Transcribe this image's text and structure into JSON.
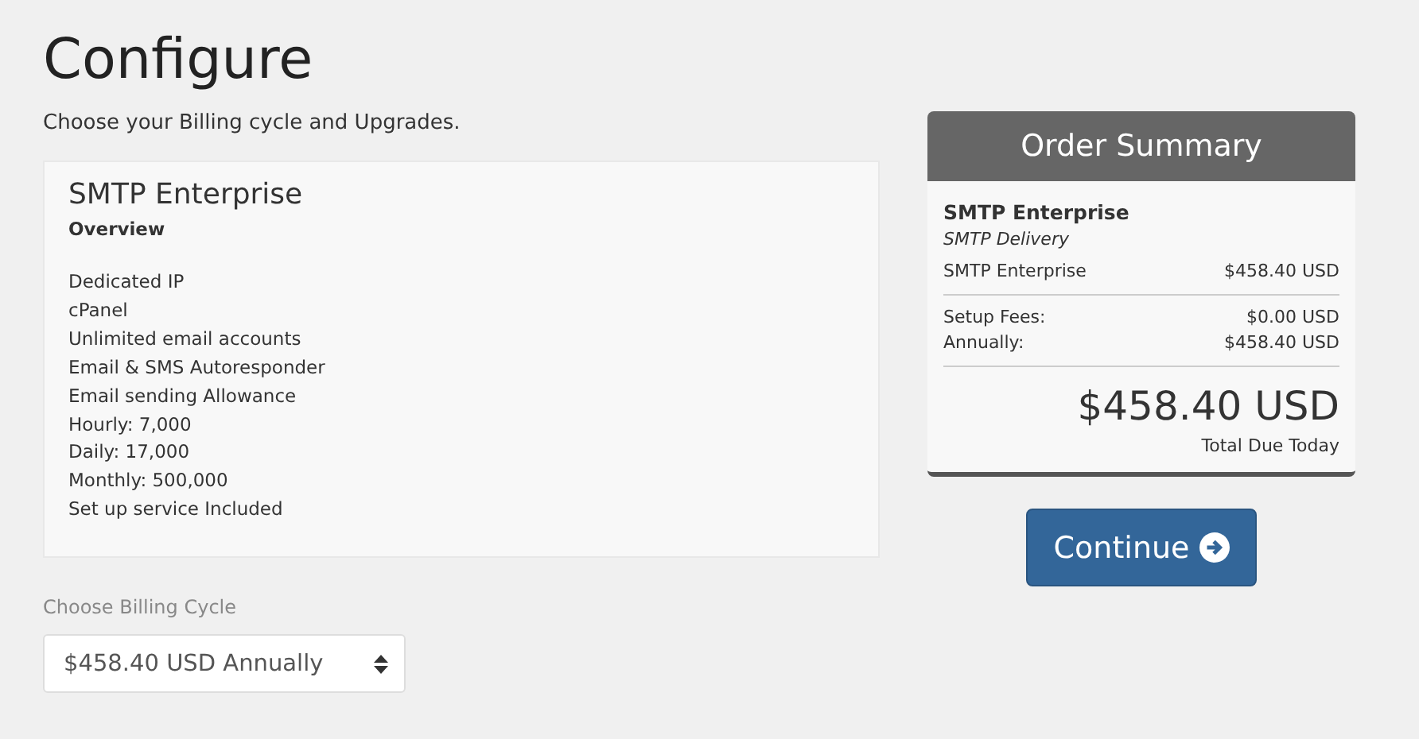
{
  "page": {
    "title": "Configure",
    "subtitle": "Choose your Billing cycle and Upgrades."
  },
  "product": {
    "name": "SMTP Enterprise",
    "section": "Overview",
    "features": [
      "Dedicated IP",
      "cPanel",
      "Unlimited email accounts",
      "Email & SMS Autoresponder",
      "Email sending Allowance",
      "Hourly: 7,000",
      "Daily: 17,000",
      "Monthly: 500,000",
      "Set up service Included"
    ]
  },
  "billing": {
    "label": "Choose Billing Cycle",
    "value": "$458.40 USD Annually"
  },
  "summary": {
    "title": "Order Summary",
    "product": "SMTP Enterprise",
    "group": "SMTP Delivery",
    "lines": [
      {
        "label": "SMTP Enterprise",
        "amount": "$458.40 USD"
      }
    ],
    "fees": [
      {
        "label": "Setup Fees:",
        "amount": "$0.00 USD"
      },
      {
        "label": "Annually:",
        "amount": "$458.40 USD"
      }
    ],
    "total": "$458.40 USD",
    "total_label": "Total Due Today"
  },
  "continue_button": {
    "label": "Continue"
  }
}
